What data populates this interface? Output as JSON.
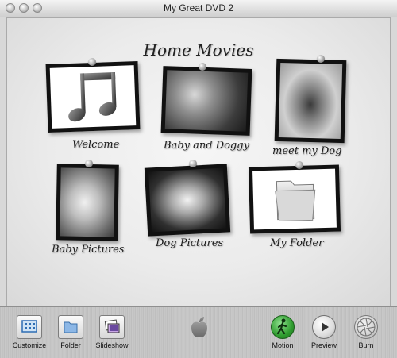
{
  "window": {
    "title": "My Great DVD 2"
  },
  "menu": {
    "title": "Home Movies",
    "buttons": [
      {
        "label": "Welcome",
        "icon": "music-notes-icon"
      },
      {
        "label": "Baby and Doggy",
        "icon": "photo-thumbnail"
      },
      {
        "label": "meet my Dog",
        "icon": "photo-thumbnail"
      },
      {
        "label": "Baby Pictures",
        "icon": "photo-thumbnail"
      },
      {
        "label": "Dog Pictures",
        "icon": "photo-thumbnail"
      },
      {
        "label": "My Folder",
        "icon": "folder-icon"
      }
    ]
  },
  "toolbar": {
    "customize": "Customize",
    "folder": "Folder",
    "slideshow": "Slideshow",
    "motion": "Motion",
    "preview": "Preview",
    "burn": "Burn"
  },
  "colors": {
    "motion_green": "#2f9d2f",
    "frame_black": "#111111"
  }
}
